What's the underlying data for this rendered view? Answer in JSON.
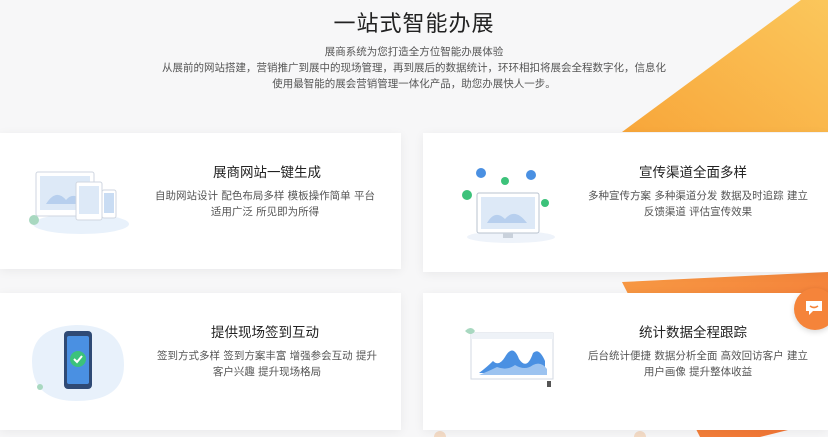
{
  "hero": {
    "title": "一站式智能办展",
    "line1": "展商系统为您打造全方位智能办展体验",
    "line2": "从展前的网站搭建，营销推广到展中的现场管理，再到展后的数据统计，环环相扣将展会全程数字化，信息化",
    "line3": "使用最智能的展会营销管理一体化产品，助您办展快人一步。"
  },
  "cards": [
    {
      "title": "展商网站一键生成",
      "desc1": "自助网站设计 配色布局多样 模板操作简单 平台",
      "desc2": "适用广泛 所见即为所得",
      "icon": "devices-illustration"
    },
    {
      "title": "宣传渠道全面多样",
      "desc1": "多种宣传方案 多种渠道分发 数据及时追踪 建立",
      "desc2": "反馈渠道 评估宣传效果",
      "icon": "monitor-social-illustration"
    },
    {
      "title": "提供现场签到互动",
      "desc1": "签到方式多样 签到方案丰富 增强参会互动 提升",
      "desc2": "客户兴趣 提升现场格局",
      "icon": "phone-checkin-illustration"
    },
    {
      "title": "统计数据全程跟踪",
      "desc1": "后台统计便捷 数据分析全面 高效回访客户 建立",
      "desc2": "用户画像 提升整体收益",
      "icon": "data-chart-illustration"
    }
  ],
  "colors": {
    "accent": "#f5843a",
    "accent_light": "#f9b55b",
    "illus_blue": "#4a90e2",
    "illus_green": "#3cc27a"
  }
}
